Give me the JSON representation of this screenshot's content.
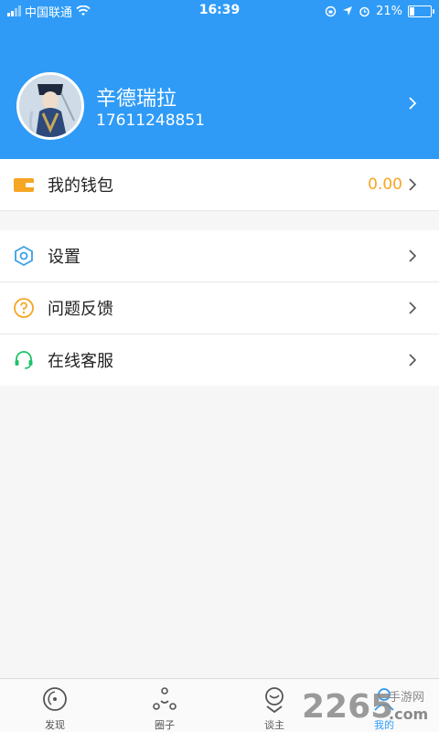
{
  "status_bar": {
    "carrier": "中国联通",
    "time": "16:39",
    "battery": "21%",
    "battery_level": 0.21
  },
  "profile": {
    "username": "辛德瑞拉",
    "phone": "17611248851"
  },
  "wallet": {
    "label": "我的钱包",
    "amount": "0.00"
  },
  "menu": {
    "items": [
      {
        "label": "设置",
        "icon": "settings-hexagon-icon"
      },
      {
        "label": "问题反馈",
        "icon": "question-circle-icon"
      },
      {
        "label": "在线客服",
        "icon": "headset-icon"
      }
    ]
  },
  "tabbar": {
    "tabs": [
      {
        "label": "发现",
        "icon": "compass-icon",
        "active": false
      },
      {
        "label": "圈子",
        "icon": "circle-group-icon",
        "active": false
      },
      {
        "label": "谈主",
        "icon": "host-icon",
        "active": false
      },
      {
        "label": "我的",
        "icon": "profile-icon",
        "active": true
      }
    ]
  },
  "watermark": {
    "text_number": "2265",
    "text_suffix": "手游网",
    "text_com": ".com"
  },
  "colors": {
    "primary": "#2f9bf7",
    "wallet_amount": "#f5a623",
    "settings_icon": "#3aa0e6",
    "feedback_icon": "#f5a623",
    "service_icon": "#20c26a"
  }
}
